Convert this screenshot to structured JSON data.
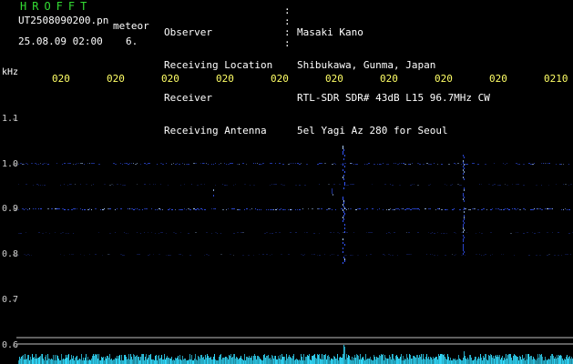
{
  "header": {
    "station_name": "HROFFT",
    "filename": "UT2508090200.pn",
    "meteor_label": "meteor",
    "datetime": "25.08.09 02:00",
    "count": "6."
  },
  "info": {
    "labels": [
      "Observer",
      "Receiving Location",
      "Receiver",
      "Receiving Antenna"
    ],
    "values": [
      "Masaki Kano",
      "Shibukawa, Gunma, Japan",
      "RTL-SDR SDR# 43dB L15 96.7MHz CW",
      "5el Yagi Az 280 for Seoul"
    ]
  },
  "y_axis": {
    "unit": "kHz",
    "labels": [
      "1.1",
      "1.0",
      "0.9",
      "0.8",
      "0.7",
      "0.6"
    ]
  },
  "time_axis": {
    "labels": [
      "020",
      "020",
      "020",
      "020",
      "020",
      "020",
      "020",
      "020",
      "020",
      "0210"
    ]
  },
  "colors": {
    "background": "#000000",
    "text_white": "#ffffff",
    "text_yellow": "#ffff66",
    "text_green": "#33dd33",
    "signal_blue": "#3355ff",
    "signal_bright": "#aaccff",
    "baseline_cyan": "#33ddff"
  }
}
